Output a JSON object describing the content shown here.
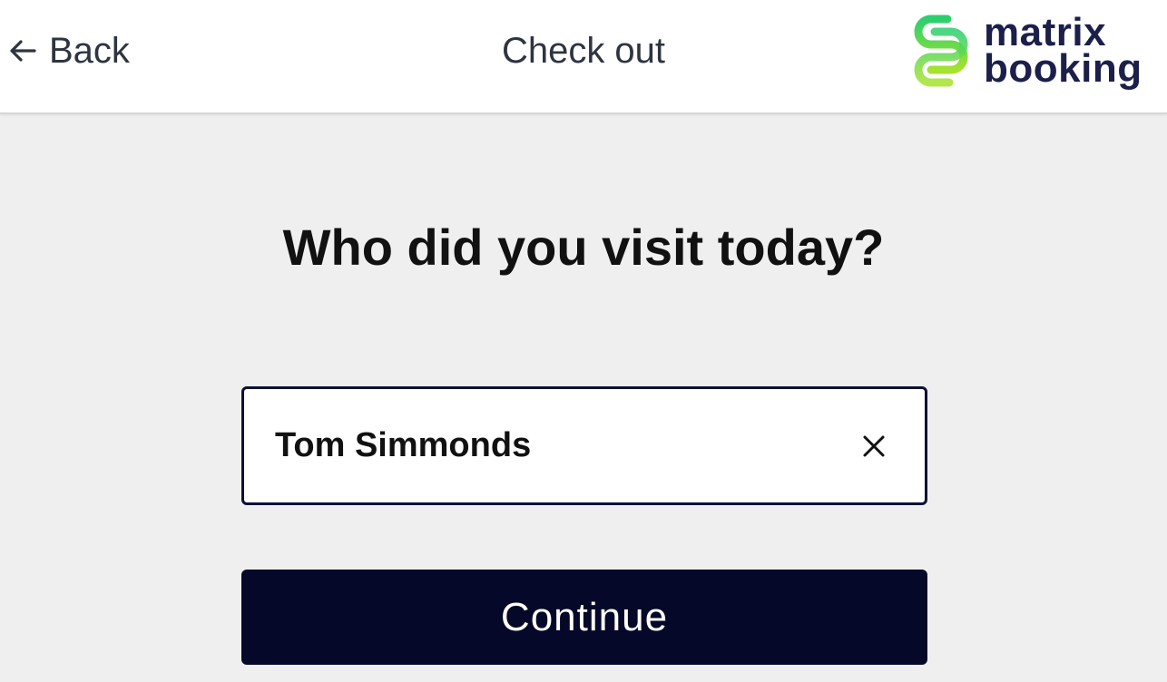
{
  "header": {
    "back_label": "Back",
    "title": "Check out",
    "logo": {
      "line1": "matrix",
      "line2": "booking",
      "icon": "matrix-booking-logo-mark"
    }
  },
  "main": {
    "question": "Who did you visit today?",
    "visit_input": {
      "value": "Tom Simmonds",
      "placeholder": ""
    },
    "clear_icon": "close-icon",
    "continue_label": "Continue"
  },
  "colors": {
    "primary": "#060829",
    "logo_green": "#2ccf6e",
    "logo_lime": "#a6e22e",
    "text_dark": "#111111",
    "background": "#efefef"
  }
}
